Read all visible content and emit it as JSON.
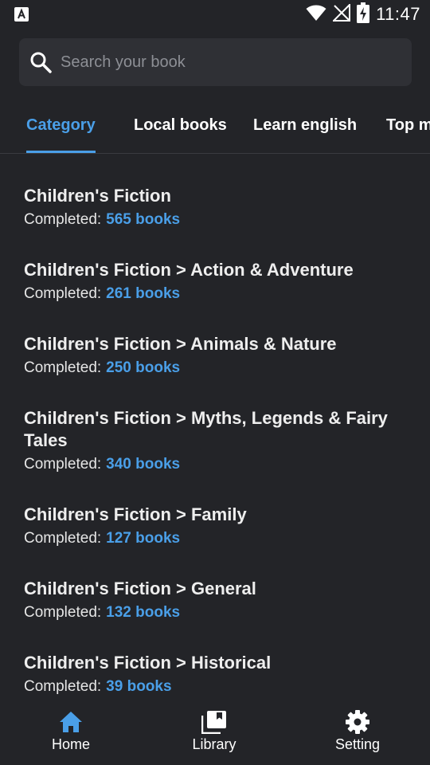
{
  "status_bar": {
    "time": "11:47"
  },
  "search": {
    "placeholder": "Search your book",
    "value": ""
  },
  "tabs": [
    {
      "label": "Category",
      "active": true
    },
    {
      "label": "Local books",
      "active": false
    },
    {
      "label": "Learn english",
      "active": false
    },
    {
      "label": "Top m",
      "active": false
    }
  ],
  "categories": [
    {
      "title": "Children's Fiction",
      "label": "Completed:",
      "count": "565 books"
    },
    {
      "title": "Children's Fiction > Action & Adventure",
      "label": "Completed:",
      "count": "261 books"
    },
    {
      "title": "Children's Fiction > Animals & Nature",
      "label": "Completed:",
      "count": "250 books"
    },
    {
      "title": "Children's Fiction > Myths, Legends & Fairy Tales",
      "label": "Completed:",
      "count": "340 books"
    },
    {
      "title": "Children's Fiction > Family",
      "label": "Completed:",
      "count": "127 books"
    },
    {
      "title": "Children's Fiction > General",
      "label": "Completed:",
      "count": "132 books"
    },
    {
      "title": "Children's Fiction > Historical",
      "label": "Completed:",
      "count": "39 books"
    }
  ],
  "bottom_nav": [
    {
      "label": "Home",
      "icon": "home-icon",
      "active": true
    },
    {
      "label": "Library",
      "icon": "library-icon",
      "active": false
    },
    {
      "label": "Setting",
      "icon": "gear-icon",
      "active": false
    }
  ],
  "colors": {
    "background": "#232428",
    "accent": "#4a9fe8",
    "search_bg": "#2f3035"
  }
}
